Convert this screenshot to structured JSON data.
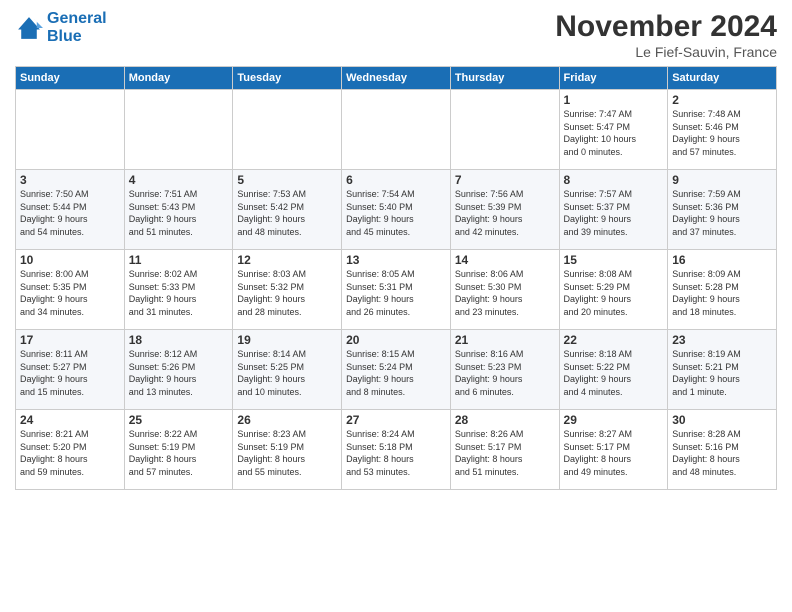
{
  "logo": {
    "line1": "General",
    "line2": "Blue"
  },
  "title": "November 2024",
  "location": "Le Fief-Sauvin, France",
  "days_of_week": [
    "Sunday",
    "Monday",
    "Tuesday",
    "Wednesday",
    "Thursday",
    "Friday",
    "Saturday"
  ],
  "weeks": [
    [
      {
        "day": "",
        "info": ""
      },
      {
        "day": "",
        "info": ""
      },
      {
        "day": "",
        "info": ""
      },
      {
        "day": "",
        "info": ""
      },
      {
        "day": "",
        "info": ""
      },
      {
        "day": "1",
        "info": "Sunrise: 7:47 AM\nSunset: 5:47 PM\nDaylight: 10 hours\nand 0 minutes."
      },
      {
        "day": "2",
        "info": "Sunrise: 7:48 AM\nSunset: 5:46 PM\nDaylight: 9 hours\nand 57 minutes."
      }
    ],
    [
      {
        "day": "3",
        "info": "Sunrise: 7:50 AM\nSunset: 5:44 PM\nDaylight: 9 hours\nand 54 minutes."
      },
      {
        "day": "4",
        "info": "Sunrise: 7:51 AM\nSunset: 5:43 PM\nDaylight: 9 hours\nand 51 minutes."
      },
      {
        "day": "5",
        "info": "Sunrise: 7:53 AM\nSunset: 5:42 PM\nDaylight: 9 hours\nand 48 minutes."
      },
      {
        "day": "6",
        "info": "Sunrise: 7:54 AM\nSunset: 5:40 PM\nDaylight: 9 hours\nand 45 minutes."
      },
      {
        "day": "7",
        "info": "Sunrise: 7:56 AM\nSunset: 5:39 PM\nDaylight: 9 hours\nand 42 minutes."
      },
      {
        "day": "8",
        "info": "Sunrise: 7:57 AM\nSunset: 5:37 PM\nDaylight: 9 hours\nand 39 minutes."
      },
      {
        "day": "9",
        "info": "Sunrise: 7:59 AM\nSunset: 5:36 PM\nDaylight: 9 hours\nand 37 minutes."
      }
    ],
    [
      {
        "day": "10",
        "info": "Sunrise: 8:00 AM\nSunset: 5:35 PM\nDaylight: 9 hours\nand 34 minutes."
      },
      {
        "day": "11",
        "info": "Sunrise: 8:02 AM\nSunset: 5:33 PM\nDaylight: 9 hours\nand 31 minutes."
      },
      {
        "day": "12",
        "info": "Sunrise: 8:03 AM\nSunset: 5:32 PM\nDaylight: 9 hours\nand 28 minutes."
      },
      {
        "day": "13",
        "info": "Sunrise: 8:05 AM\nSunset: 5:31 PM\nDaylight: 9 hours\nand 26 minutes."
      },
      {
        "day": "14",
        "info": "Sunrise: 8:06 AM\nSunset: 5:30 PM\nDaylight: 9 hours\nand 23 minutes."
      },
      {
        "day": "15",
        "info": "Sunrise: 8:08 AM\nSunset: 5:29 PM\nDaylight: 9 hours\nand 20 minutes."
      },
      {
        "day": "16",
        "info": "Sunrise: 8:09 AM\nSunset: 5:28 PM\nDaylight: 9 hours\nand 18 minutes."
      }
    ],
    [
      {
        "day": "17",
        "info": "Sunrise: 8:11 AM\nSunset: 5:27 PM\nDaylight: 9 hours\nand 15 minutes."
      },
      {
        "day": "18",
        "info": "Sunrise: 8:12 AM\nSunset: 5:26 PM\nDaylight: 9 hours\nand 13 minutes."
      },
      {
        "day": "19",
        "info": "Sunrise: 8:14 AM\nSunset: 5:25 PM\nDaylight: 9 hours\nand 10 minutes."
      },
      {
        "day": "20",
        "info": "Sunrise: 8:15 AM\nSunset: 5:24 PM\nDaylight: 9 hours\nand 8 minutes."
      },
      {
        "day": "21",
        "info": "Sunrise: 8:16 AM\nSunset: 5:23 PM\nDaylight: 9 hours\nand 6 minutes."
      },
      {
        "day": "22",
        "info": "Sunrise: 8:18 AM\nSunset: 5:22 PM\nDaylight: 9 hours\nand 4 minutes."
      },
      {
        "day": "23",
        "info": "Sunrise: 8:19 AM\nSunset: 5:21 PM\nDaylight: 9 hours\nand 1 minute."
      }
    ],
    [
      {
        "day": "24",
        "info": "Sunrise: 8:21 AM\nSunset: 5:20 PM\nDaylight: 8 hours\nand 59 minutes."
      },
      {
        "day": "25",
        "info": "Sunrise: 8:22 AM\nSunset: 5:19 PM\nDaylight: 8 hours\nand 57 minutes."
      },
      {
        "day": "26",
        "info": "Sunrise: 8:23 AM\nSunset: 5:19 PM\nDaylight: 8 hours\nand 55 minutes."
      },
      {
        "day": "27",
        "info": "Sunrise: 8:24 AM\nSunset: 5:18 PM\nDaylight: 8 hours\nand 53 minutes."
      },
      {
        "day": "28",
        "info": "Sunrise: 8:26 AM\nSunset: 5:17 PM\nDaylight: 8 hours\nand 51 minutes."
      },
      {
        "day": "29",
        "info": "Sunrise: 8:27 AM\nSunset: 5:17 PM\nDaylight: 8 hours\nand 49 minutes."
      },
      {
        "day": "30",
        "info": "Sunrise: 8:28 AM\nSunset: 5:16 PM\nDaylight: 8 hours\nand 48 minutes."
      }
    ]
  ]
}
